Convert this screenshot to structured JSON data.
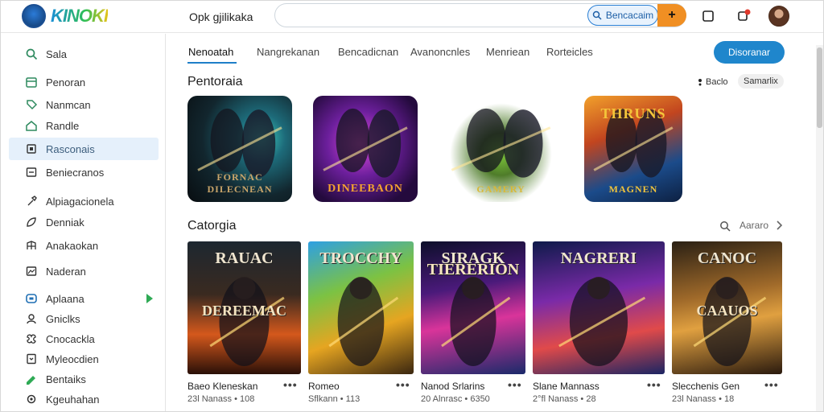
{
  "app": {
    "logo_text": "KINOKI",
    "name": "Opk gjilikaka",
    "colors": {
      "accent": "#1f86cc",
      "orange": "#f08f23",
      "active_bg": "#e5f0fb"
    }
  },
  "search": {
    "placeholder": "",
    "button_label": "Bencacaim",
    "orange_button_label": "+"
  },
  "header_icons": [
    "square-icon",
    "notification-icon",
    "user-avatar"
  ],
  "sidebar": {
    "items": [
      {
        "label": "Sala",
        "icon": "search-icon"
      },
      {
        "label": "Penoran",
        "icon": "calendar-icon"
      },
      {
        "label": "Nanmcan",
        "icon": "tag-icon"
      },
      {
        "label": "Randle",
        "icon": "home-icon"
      },
      {
        "label": "Rasconais",
        "icon": "library-icon",
        "active": true
      },
      {
        "label": "Beniecranos",
        "icon": "box-icon"
      },
      {
        "label": "Alpiagacionela",
        "icon": "wrench-icon"
      },
      {
        "label": "Denniak",
        "icon": "leaf-icon"
      },
      {
        "label": "Anakaokan",
        "icon": "grid-icon"
      },
      {
        "label": "Naderan",
        "icon": "image-icon"
      },
      {
        "label": "Aplaana",
        "icon": "gamepad-icon",
        "has_arrow": true
      },
      {
        "label": "Gniclks",
        "icon": "person-icon"
      },
      {
        "label": "Cnocackla",
        "icon": "puzzle-icon"
      },
      {
        "label": "Myleocdien",
        "icon": "file-icon"
      },
      {
        "label": "Bentaiks",
        "icon": "pencil-icon"
      },
      {
        "label": "Kgeuhahan",
        "icon": "settings-icon"
      }
    ]
  },
  "tabs": [
    "Nenoatah",
    "Nangrekanan",
    "Bencadicnan",
    "Avanoncnles",
    "Menriean",
    "Rorteicles"
  ],
  "primary_button": "Disoranar",
  "featured": {
    "title": "Pentoraia",
    "sort_label": "Baclo",
    "chip": "Samarlix",
    "tiles": [
      {
        "caption": "FORNAC DILECNEAN"
      },
      {
        "caption": "DINEEBAON"
      },
      {
        "caption": "GAMERY"
      },
      {
        "caption": "MAGNEN",
        "top_caption": "THRUNS"
      }
    ]
  },
  "categoria": {
    "title": "Catorgia",
    "more_label": "Aararo",
    "cards": [
      {
        "art_top": "RAUAC",
        "art_main": "DEREEMAC",
        "title": "Baeo Kleneskan",
        "meta": "23l Nanass • 108"
      },
      {
        "art_top": "TROCCHY",
        "art_main": "",
        "title": "Romeo",
        "meta": "Sflkann • 113"
      },
      {
        "art_top": "SIRAGK",
        "art_main": "TIERERION",
        "title": "Nanod Srlarins",
        "meta": "20 Alnrasc • 6350"
      },
      {
        "art_top": "NAGRERI",
        "art_main": "",
        "title": "Slane Mannass",
        "meta": "2°fl Nanass • 28"
      },
      {
        "art_top": "CANOC",
        "art_main": "CAAUOS",
        "title": "Slecchenis Gen",
        "meta": "23l Nanass • 18"
      }
    ]
  }
}
